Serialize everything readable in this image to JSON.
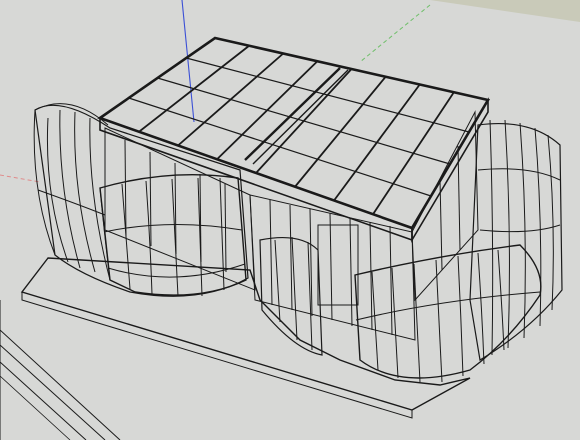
{
  "viewport": {
    "kind": "3d-model-viewport",
    "render_style": "x-ray wireframe",
    "colors": {
      "background": "#d6d7d5",
      "ground": "#d2d3d1",
      "building_fill": "#e6e8e6",
      "line": "#1a1a1a",
      "axis_blue": "#3a4fd6",
      "axis_green": "#6fbf6a",
      "axis_red": "#e08a8a"
    }
  },
  "model": {
    "roof": {
      "rafter_count": 8,
      "purlin_count": 4
    },
    "pods": [
      "left-curved-glass-pod",
      "right-curved-glass-pod"
    ]
  }
}
